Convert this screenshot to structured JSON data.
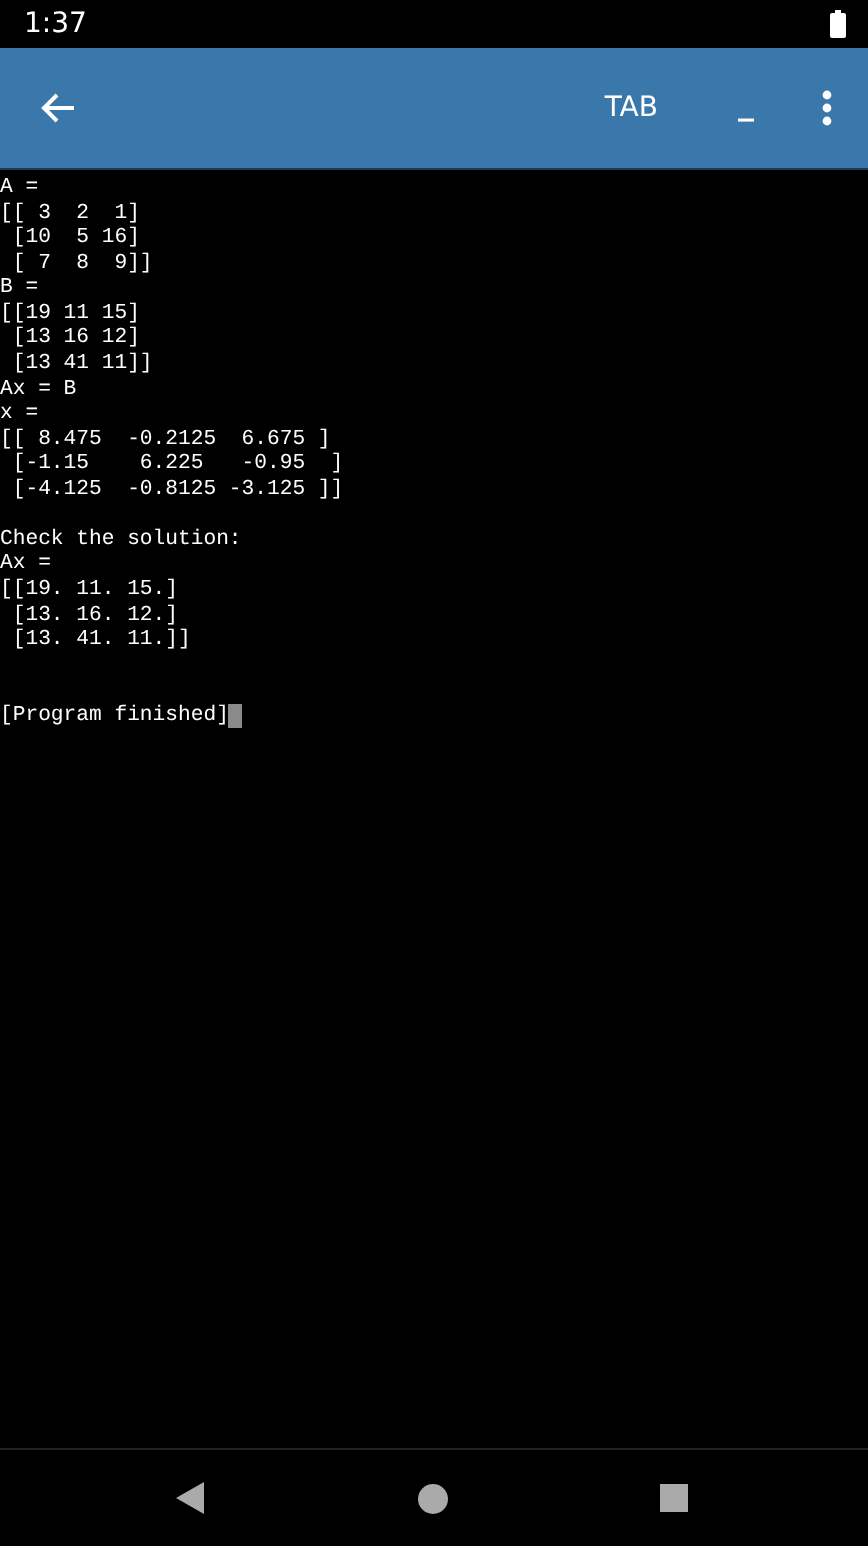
{
  "status_bar": {
    "time": "1:37"
  },
  "toolbar": {
    "tab_label": "TAB",
    "minimize_label": "_"
  },
  "terminal": {
    "lines": [
      {
        "kind": "text",
        "text": "A ="
      },
      {
        "kind": "text",
        "text": "[[ 3  2  1]"
      },
      {
        "kind": "text",
        "text": " [10  5 16]"
      },
      {
        "kind": "text",
        "text": " [ 7  8  9]]"
      },
      {
        "kind": "text",
        "text": "B ="
      },
      {
        "kind": "text",
        "text": "[[19 11 15]"
      },
      {
        "kind": "text",
        "text": " [13 16 12]"
      },
      {
        "kind": "text",
        "text": " [13 41 11]]"
      },
      {
        "kind": "text",
        "text": "Ax = B"
      },
      {
        "kind": "text",
        "text": "x ="
      },
      {
        "kind": "text",
        "text": "[[ 8.475  -0.2125  6.675 ]"
      },
      {
        "kind": "text",
        "text": " [-1.15    6.225   -0.95  ]"
      },
      {
        "kind": "text",
        "text": " [-4.125  -0.8125 -3.125 ]]"
      },
      {
        "kind": "blank"
      },
      {
        "kind": "text",
        "text": "Check the solution:"
      },
      {
        "kind": "text",
        "text": "Ax ="
      },
      {
        "kind": "text",
        "text": "[[19. 11. 15.]"
      },
      {
        "kind": "text",
        "text": " [13. 16. 12.]"
      },
      {
        "kind": "text",
        "text": " [13. 41. 11.]]"
      },
      {
        "kind": "blank"
      },
      {
        "kind": "blank"
      },
      {
        "kind": "text",
        "text": "[Program finished]",
        "cursor": true
      }
    ]
  }
}
